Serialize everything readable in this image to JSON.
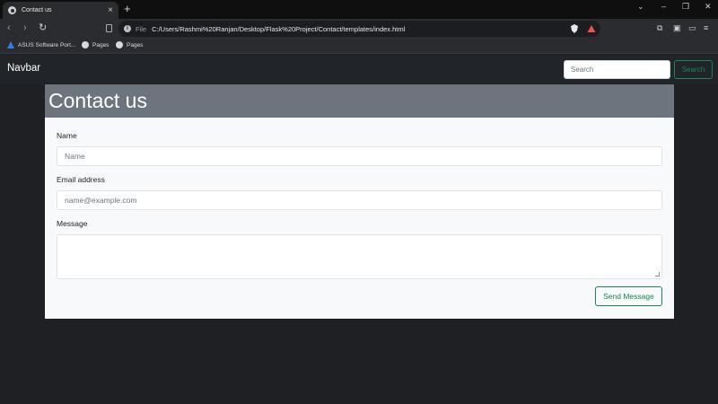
{
  "browser": {
    "tab_title": "Contact us",
    "address_scheme": "File",
    "address_url": "C:/Users/Rashmi%20Ranjan/Desktop/Flask%20Project/Contact/templates/index.html",
    "bookmarks": [
      "ASUS Software Port...",
      "Pages",
      "Pages"
    ],
    "icons": {
      "tab_close": "close-icon",
      "new_tab": "plus-icon",
      "back": "back-arrow-icon",
      "forward": "forward-arrow-icon",
      "reload": "reload-icon",
      "bookmark": "bookmark-icon",
      "info": "info-icon",
      "brave_shield": "shield-icon",
      "brave_rewards": "triangle-icon",
      "menu": "hamburger-icon"
    }
  },
  "navbar": {
    "brand": "Navbar",
    "search_placeholder": "Search",
    "search_button": "Search"
  },
  "form": {
    "heading": "Contact us",
    "name_label": "Name",
    "name_placeholder": "Name",
    "email_label": "Email address",
    "email_placeholder": "name@example.com",
    "message_label": "Message",
    "submit": "Send Message"
  },
  "colors": {
    "page_bg": "#1e2024",
    "navbar_bg": "#212429",
    "header_bg": "#6c757d",
    "card_bg": "#f8f9fa",
    "accent_green": "#198754"
  }
}
